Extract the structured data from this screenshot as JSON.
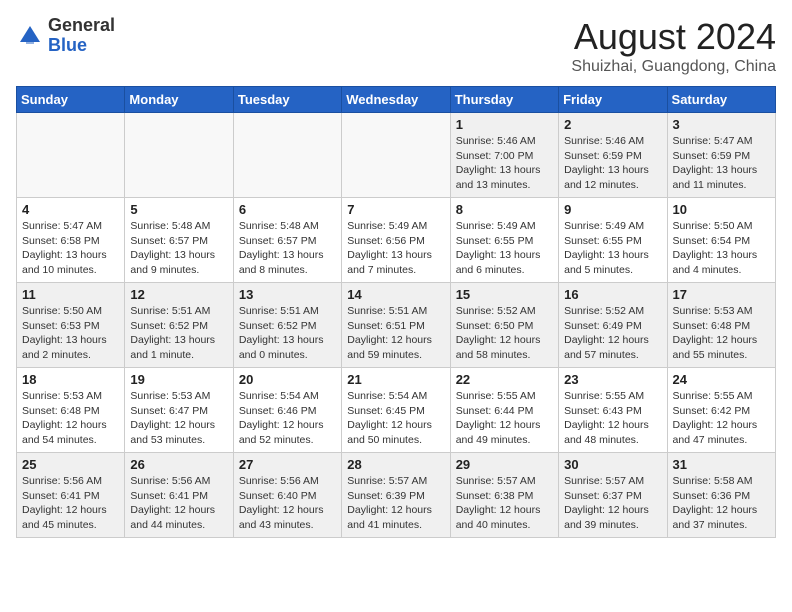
{
  "header": {
    "logo_general": "General",
    "logo_blue": "Blue",
    "month": "August 2024",
    "location": "Shuizhai, Guangdong, China"
  },
  "days_of_week": [
    "Sunday",
    "Monday",
    "Tuesday",
    "Wednesday",
    "Thursday",
    "Friday",
    "Saturday"
  ],
  "weeks": [
    [
      {
        "day": "",
        "info": "",
        "empty": true
      },
      {
        "day": "",
        "info": "",
        "empty": true
      },
      {
        "day": "",
        "info": "",
        "empty": true
      },
      {
        "day": "",
        "info": "",
        "empty": true
      },
      {
        "day": "1",
        "info": "Sunrise: 5:46 AM\nSunset: 7:00 PM\nDaylight: 13 hours\nand 13 minutes.",
        "empty": false
      },
      {
        "day": "2",
        "info": "Sunrise: 5:46 AM\nSunset: 6:59 PM\nDaylight: 13 hours\nand 12 minutes.",
        "empty": false
      },
      {
        "day": "3",
        "info": "Sunrise: 5:47 AM\nSunset: 6:59 PM\nDaylight: 13 hours\nand 11 minutes.",
        "empty": false
      }
    ],
    [
      {
        "day": "4",
        "info": "Sunrise: 5:47 AM\nSunset: 6:58 PM\nDaylight: 13 hours\nand 10 minutes.",
        "empty": false
      },
      {
        "day": "5",
        "info": "Sunrise: 5:48 AM\nSunset: 6:57 PM\nDaylight: 13 hours\nand 9 minutes.",
        "empty": false
      },
      {
        "day": "6",
        "info": "Sunrise: 5:48 AM\nSunset: 6:57 PM\nDaylight: 13 hours\nand 8 minutes.",
        "empty": false
      },
      {
        "day": "7",
        "info": "Sunrise: 5:49 AM\nSunset: 6:56 PM\nDaylight: 13 hours\nand 7 minutes.",
        "empty": false
      },
      {
        "day": "8",
        "info": "Sunrise: 5:49 AM\nSunset: 6:55 PM\nDaylight: 13 hours\nand 6 minutes.",
        "empty": false
      },
      {
        "day": "9",
        "info": "Sunrise: 5:49 AM\nSunset: 6:55 PM\nDaylight: 13 hours\nand 5 minutes.",
        "empty": false
      },
      {
        "day": "10",
        "info": "Sunrise: 5:50 AM\nSunset: 6:54 PM\nDaylight: 13 hours\nand 4 minutes.",
        "empty": false
      }
    ],
    [
      {
        "day": "11",
        "info": "Sunrise: 5:50 AM\nSunset: 6:53 PM\nDaylight: 13 hours\nand 2 minutes.",
        "empty": false
      },
      {
        "day": "12",
        "info": "Sunrise: 5:51 AM\nSunset: 6:52 PM\nDaylight: 13 hours\nand 1 minute.",
        "empty": false
      },
      {
        "day": "13",
        "info": "Sunrise: 5:51 AM\nSunset: 6:52 PM\nDaylight: 13 hours\nand 0 minutes.",
        "empty": false
      },
      {
        "day": "14",
        "info": "Sunrise: 5:51 AM\nSunset: 6:51 PM\nDaylight: 12 hours\nand 59 minutes.",
        "empty": false
      },
      {
        "day": "15",
        "info": "Sunrise: 5:52 AM\nSunset: 6:50 PM\nDaylight: 12 hours\nand 58 minutes.",
        "empty": false
      },
      {
        "day": "16",
        "info": "Sunrise: 5:52 AM\nSunset: 6:49 PM\nDaylight: 12 hours\nand 57 minutes.",
        "empty": false
      },
      {
        "day": "17",
        "info": "Sunrise: 5:53 AM\nSunset: 6:48 PM\nDaylight: 12 hours\nand 55 minutes.",
        "empty": false
      }
    ],
    [
      {
        "day": "18",
        "info": "Sunrise: 5:53 AM\nSunset: 6:48 PM\nDaylight: 12 hours\nand 54 minutes.",
        "empty": false
      },
      {
        "day": "19",
        "info": "Sunrise: 5:53 AM\nSunset: 6:47 PM\nDaylight: 12 hours\nand 53 minutes.",
        "empty": false
      },
      {
        "day": "20",
        "info": "Sunrise: 5:54 AM\nSunset: 6:46 PM\nDaylight: 12 hours\nand 52 minutes.",
        "empty": false
      },
      {
        "day": "21",
        "info": "Sunrise: 5:54 AM\nSunset: 6:45 PM\nDaylight: 12 hours\nand 50 minutes.",
        "empty": false
      },
      {
        "day": "22",
        "info": "Sunrise: 5:55 AM\nSunset: 6:44 PM\nDaylight: 12 hours\nand 49 minutes.",
        "empty": false
      },
      {
        "day": "23",
        "info": "Sunrise: 5:55 AM\nSunset: 6:43 PM\nDaylight: 12 hours\nand 48 minutes.",
        "empty": false
      },
      {
        "day": "24",
        "info": "Sunrise: 5:55 AM\nSunset: 6:42 PM\nDaylight: 12 hours\nand 47 minutes.",
        "empty": false
      }
    ],
    [
      {
        "day": "25",
        "info": "Sunrise: 5:56 AM\nSunset: 6:41 PM\nDaylight: 12 hours\nand 45 minutes.",
        "empty": false
      },
      {
        "day": "26",
        "info": "Sunrise: 5:56 AM\nSunset: 6:41 PM\nDaylight: 12 hours\nand 44 minutes.",
        "empty": false
      },
      {
        "day": "27",
        "info": "Sunrise: 5:56 AM\nSunset: 6:40 PM\nDaylight: 12 hours\nand 43 minutes.",
        "empty": false
      },
      {
        "day": "28",
        "info": "Sunrise: 5:57 AM\nSunset: 6:39 PM\nDaylight: 12 hours\nand 41 minutes.",
        "empty": false
      },
      {
        "day": "29",
        "info": "Sunrise: 5:57 AM\nSunset: 6:38 PM\nDaylight: 12 hours\nand 40 minutes.",
        "empty": false
      },
      {
        "day": "30",
        "info": "Sunrise: 5:57 AM\nSunset: 6:37 PM\nDaylight: 12 hours\nand 39 minutes.",
        "empty": false
      },
      {
        "day": "31",
        "info": "Sunrise: 5:58 AM\nSunset: 6:36 PM\nDaylight: 12 hours\nand 37 minutes.",
        "empty": false
      }
    ]
  ]
}
